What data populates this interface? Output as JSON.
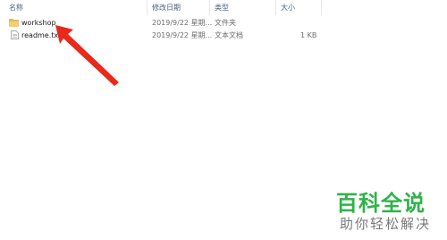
{
  "columns": {
    "name": "名称",
    "modified": "修改日期",
    "type": "类型",
    "size": "大小"
  },
  "files": [
    {
      "name": "workshop",
      "modified": "2019/9/22 星期...",
      "type": "文件夹",
      "size": "",
      "icon": "folder-icon"
    },
    {
      "name": "readme.txt",
      "modified": "2019/9/22 星期...",
      "type": "文本文档",
      "size": "1 KB",
      "icon": "text-file-icon"
    }
  ],
  "watermark": {
    "logo": "百科全说",
    "slogan": "助你轻松解决"
  },
  "colors": {
    "header_text": "#4d6185",
    "arrow": "#e8291c",
    "watermark_green": "#2fb34a",
    "folder": "#e9b94f"
  }
}
